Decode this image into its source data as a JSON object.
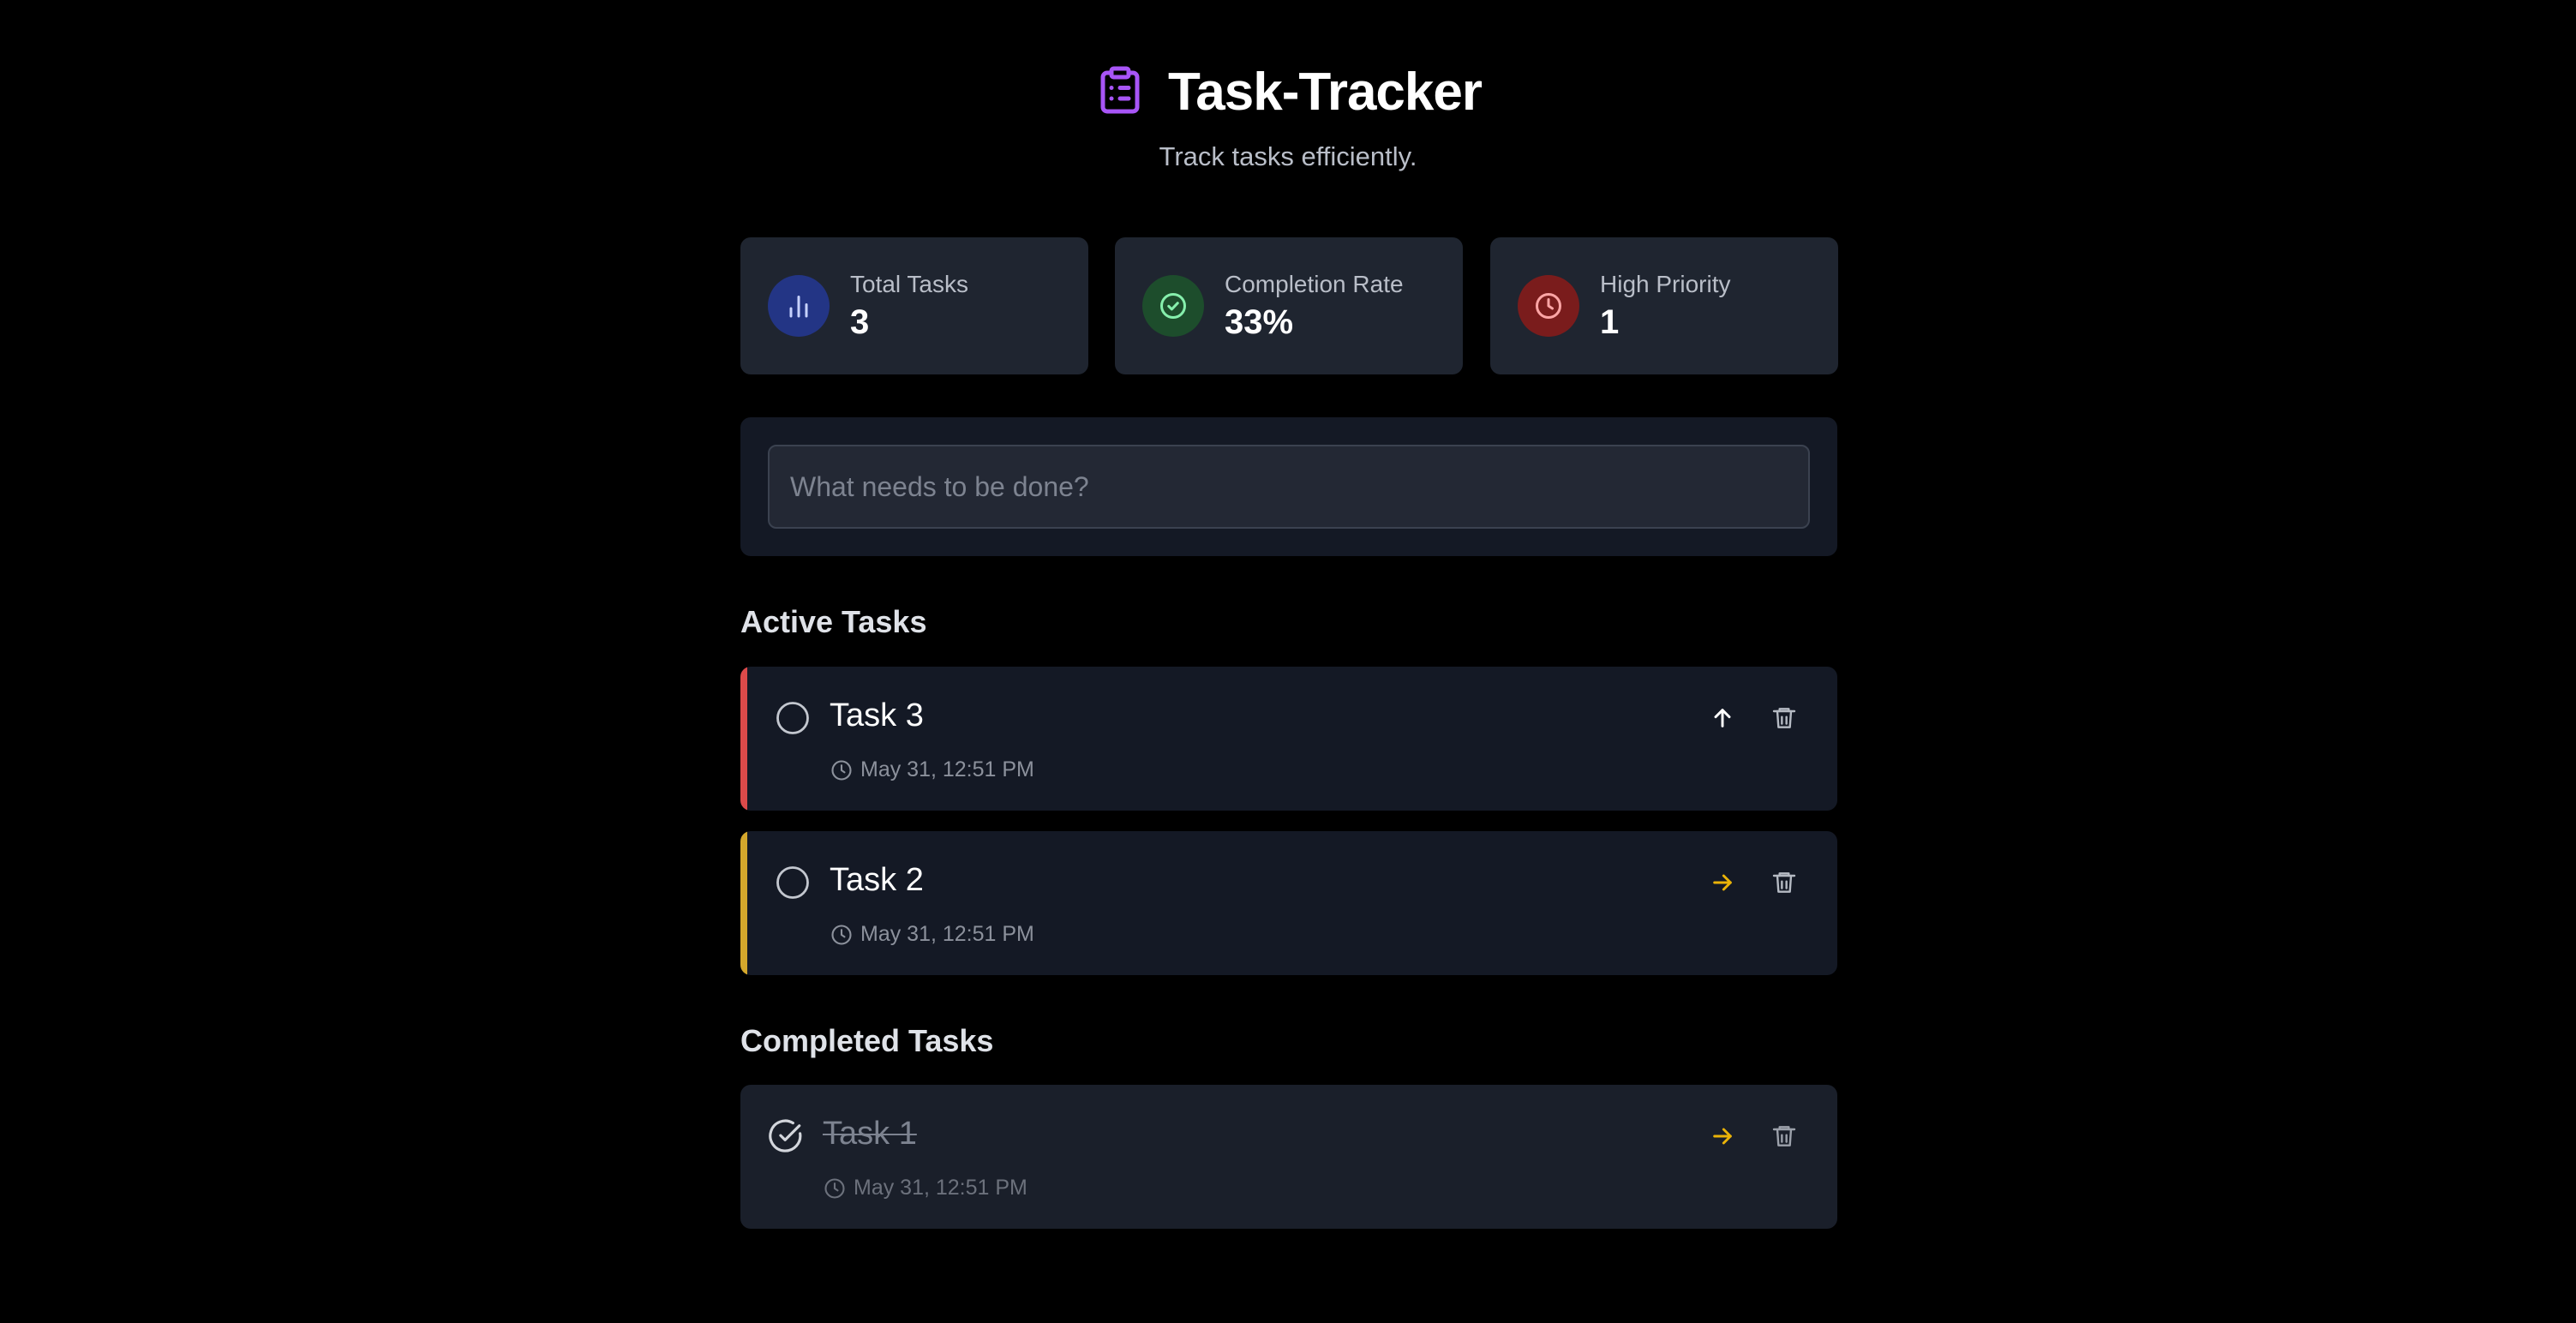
{
  "app": {
    "title": "Task-Tracker",
    "subtitle": "Track tasks efficiently.",
    "accent_color": "#a855f7",
    "logo_icon": "clipboard-list-icon"
  },
  "stats": [
    {
      "label": "Total Tasks",
      "value": "3",
      "icon": "bar-chart-icon",
      "icon_bg": "#233585",
      "icon_color": "#c7d2fe"
    },
    {
      "label": "Completion Rate",
      "value": "33%",
      "icon": "check-circle-icon",
      "icon_bg": "#1d4d2c",
      "icon_color": "#86efac"
    },
    {
      "label": "High Priority",
      "value": "1",
      "icon": "clock-icon",
      "icon_bg": "#7a1c1c",
      "icon_color": "#fca5a5"
    }
  ],
  "new_task": {
    "placeholder": "What needs to be done?",
    "value": ""
  },
  "active_section": {
    "title": "Active Tasks",
    "tasks": [
      {
        "name": "Task 3",
        "timestamp": "May 31, 12:51 PM",
        "priority": "high",
        "priority_color": "#dc4a4a",
        "priority_icon": "arrow-up-icon",
        "priority_icon_color": "#ffffff"
      },
      {
        "name": "Task 2",
        "timestamp": "May 31, 12:51 PM",
        "priority": "medium",
        "priority_color": "#d4a72c",
        "priority_icon": "arrow-right-icon",
        "priority_icon_color": "#eab308"
      }
    ]
  },
  "completed_section": {
    "title": "Completed Tasks",
    "tasks": [
      {
        "name": "Task 1",
        "timestamp": "May 31, 12:51 PM",
        "priority": "medium",
        "priority_icon": "arrow-right-icon",
        "priority_icon_color": "#eab308"
      }
    ]
  },
  "icons": {
    "delete": "trash-icon",
    "timestamp": "clock-icon",
    "unchecked": "circle-icon",
    "checked": "circle-check-icon"
  }
}
